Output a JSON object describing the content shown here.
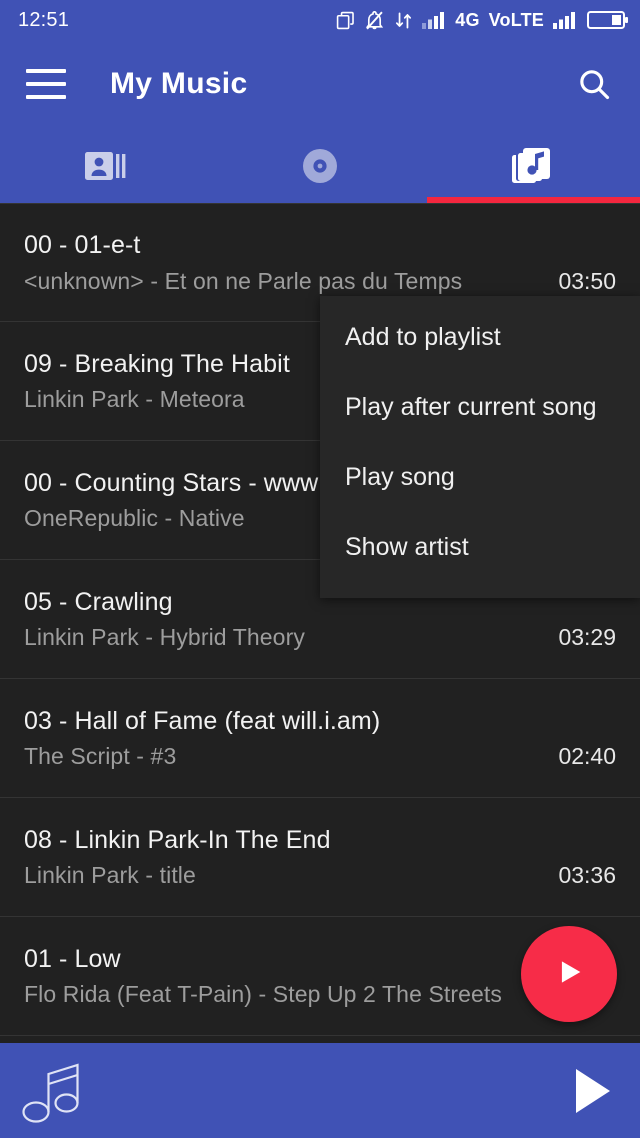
{
  "theme": {
    "primary": "#4052b5",
    "accent": "#f4273f",
    "fab": "#f72c48",
    "background": "#212121",
    "menu_background": "#272727",
    "divider": "#343434",
    "text_primary": "#f2f2f2",
    "text_secondary": "#9d9d9d"
  },
  "statusbar": {
    "clock": "12:51",
    "network_label": "4G",
    "volte_label": "VoLTE",
    "icons": [
      "screenshot-icon",
      "silent-mode-icon",
      "data-transfer-icon",
      "signal-bars-icon",
      "signal-bars-2-icon",
      "battery-icon"
    ]
  },
  "appbar": {
    "title": "My Music",
    "menu_icon": "hamburger-menu-icon",
    "search_icon": "search-icon"
  },
  "tabs": [
    {
      "name": "artists",
      "icon": "artist-card-icon",
      "active": false
    },
    {
      "name": "albums",
      "icon": "album-disc-icon",
      "active": false
    },
    {
      "name": "songs",
      "icon": "song-cards-music-note-icon",
      "active": true
    }
  ],
  "songs": [
    {
      "title": "00 - 01-e-t",
      "subtitle": "<unknown> - Et on ne Parle pas du Temps",
      "duration": "03:50"
    },
    {
      "title": "09 - Breaking The Habit",
      "subtitle": "Linkin Park - Meteora",
      "duration": ""
    },
    {
      "title": "00 - Counting Stars - www",
      "subtitle": "OneRepublic - Native",
      "duration": ""
    },
    {
      "title": "05 - Crawling",
      "subtitle": "Linkin Park - Hybrid Theory",
      "duration": "03:29"
    },
    {
      "title": "03 - Hall of Fame (feat will.i.am)",
      "subtitle": "The Script - #3",
      "duration": "02:40"
    },
    {
      "title": "08 - Linkin Park-In The End",
      "subtitle": "Linkin Park - title",
      "duration": "03:36"
    },
    {
      "title": "01 - Low",
      "subtitle": "Flo Rida (Feat T-Pain) - Step Up 2 The Streets",
      "duration": ""
    }
  ],
  "context_menu": {
    "items": [
      "Add to playlist",
      "Play after current song",
      "Play song",
      "Show artist"
    ]
  },
  "fab": {
    "icon": "play-icon"
  },
  "player_bar": {
    "artwork_icon": "music-note-icon",
    "play_icon": "play-icon"
  }
}
